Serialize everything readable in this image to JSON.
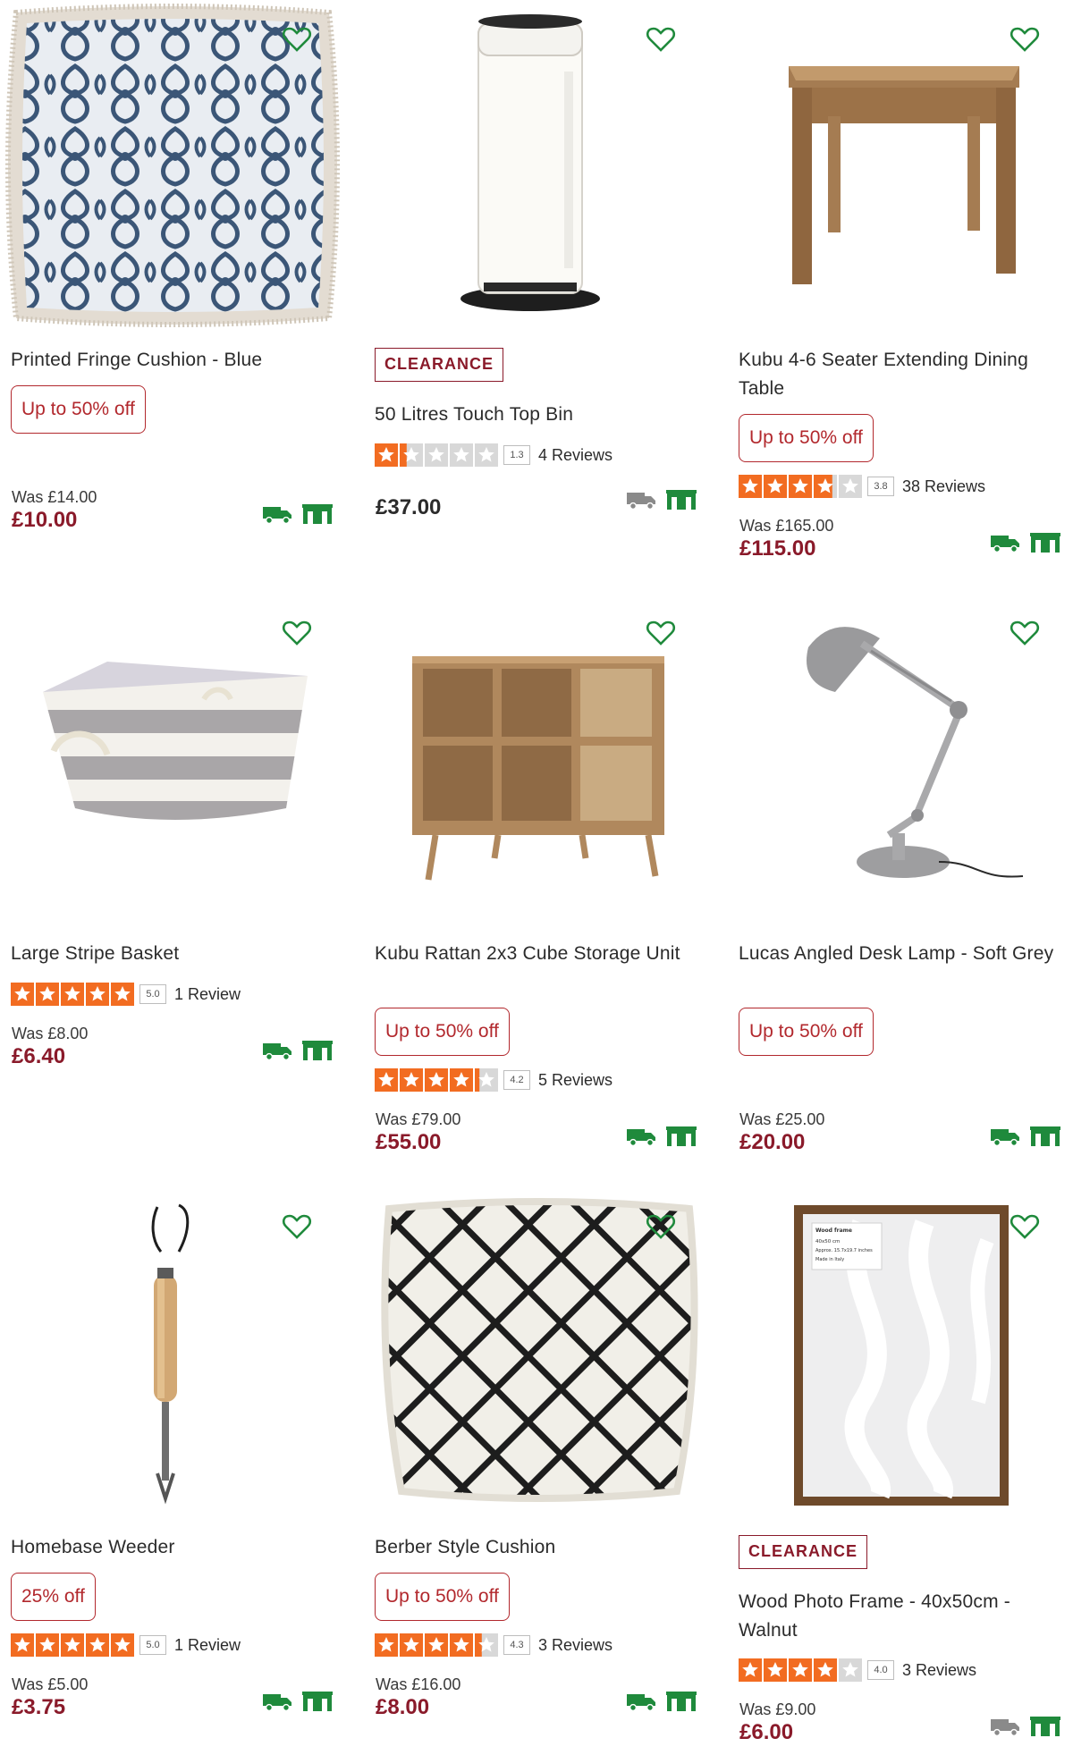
{
  "colors": {
    "sale": "#8a1a2a",
    "badge_red": "#b2282d",
    "green": "#1f8a3c",
    "star_orange": "#f26c21",
    "star_empty": "#d8d8d8",
    "grey_icon": "#8a8a8a"
  },
  "products": [
    {
      "title": "Printed Fringe Cushion - Blue",
      "badge": "Up to 50% off",
      "was": "Was £14.00",
      "price": "£10.00",
      "delivery_available": true
    },
    {
      "label": "CLEARANCE",
      "title": "50 Litres Touch Top Bin",
      "rating": 1.3,
      "score": "1.3",
      "reviews": "4 Reviews",
      "price": "£37.00",
      "delivery_available": false
    },
    {
      "title": "Kubu 4-6 Seater Extending Dining Table",
      "badge": "Up to 50% off",
      "rating": 3.8,
      "score": "3.8",
      "reviews": "38 Reviews",
      "was": "Was £165.00",
      "price": "£115.00",
      "delivery_available": true
    },
    {
      "title": "Large Stripe Basket",
      "rating": 5.0,
      "score": "5.0",
      "reviews": "1 Review",
      "was": "Was £8.00",
      "price": "£6.40",
      "delivery_available": true
    },
    {
      "title": "Kubu Rattan 2x3 Cube Storage Unit",
      "badge": "Up to 50% off",
      "rating": 4.2,
      "score": "4.2",
      "reviews": "5 Reviews",
      "was": "Was £79.00",
      "price": "£55.00",
      "delivery_available": true
    },
    {
      "title": "Lucas Angled Desk Lamp - Soft Grey",
      "badge": "Up to 50% off",
      "was": "Was £25.00",
      "price": "£20.00",
      "delivery_available": true
    },
    {
      "title": "Homebase Weeder",
      "badge": "25% off",
      "rating": 5.0,
      "score": "5.0",
      "reviews": "1 Review",
      "was": "Was £5.00",
      "price": "£3.75",
      "delivery_available": true
    },
    {
      "title": "Berber Style Cushion",
      "badge": "Up to 50% off",
      "rating": 4.3,
      "score": "4.3",
      "reviews": "3 Reviews",
      "was": "Was £16.00",
      "price": "£8.00",
      "delivery_available": true
    },
    {
      "label": "CLEARANCE",
      "title": "Wood Photo Frame - 40x50cm - Walnut",
      "rating": 4.0,
      "score": "4.0",
      "reviews": "3 Reviews",
      "was": "Was £9.00",
      "price": "£6.00",
      "delivery_available": false,
      "image_text": [
        "Wood frame",
        "40x50 cm",
        "Approx. 15.7x19.7 inches",
        "Made in Italy"
      ]
    }
  ]
}
